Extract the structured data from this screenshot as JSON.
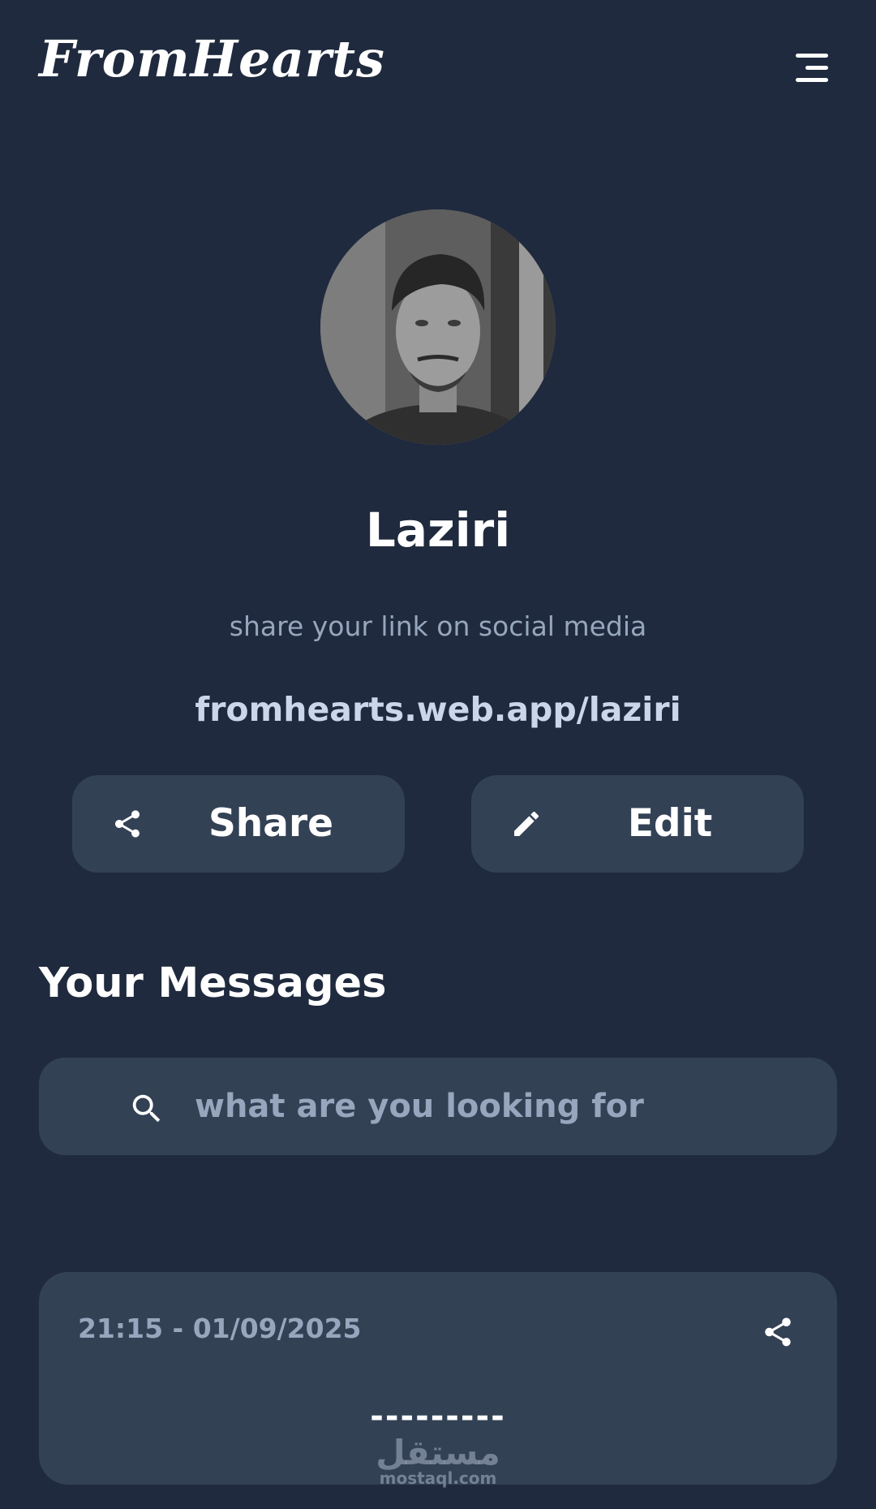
{
  "header": {
    "brand": "FromHearts",
    "menu_icon": "menu-icon"
  },
  "profile": {
    "name": "Laziri",
    "hint": "share your link on social media",
    "link": "fromhearts.web.app/laziri",
    "avatar": "avatar"
  },
  "actions": {
    "share_label": "Share",
    "share_icon": "share-icon",
    "edit_label": "Edit",
    "edit_icon": "pencil-icon"
  },
  "messages": {
    "title": "Your Messages",
    "search_placeholder": "what are you looking for",
    "search_icon": "search-icon",
    "items": [
      {
        "time": "21:15 - 01/09/2025",
        "text": "---------",
        "share_icon": "share-icon"
      }
    ]
  },
  "watermark": {
    "arabic": "مستقل",
    "latin": "mostaql.com"
  },
  "colors": {
    "background": "#1f2a3e",
    "surface": "#334155",
    "muted_text": "#97a6bd",
    "link_text": "#cbd6ea",
    "text": "#ffffff"
  }
}
